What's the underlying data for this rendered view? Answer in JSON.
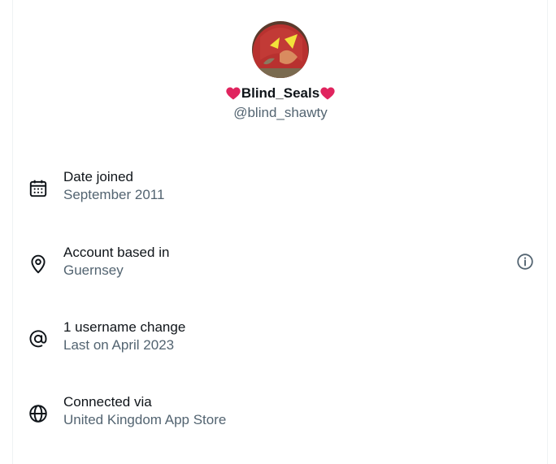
{
  "profile": {
    "display_name": "Blind_Seals",
    "handle": "@blind_shawty"
  },
  "rows": [
    {
      "icon": "calendar-icon",
      "title": "Date joined",
      "value": "September 2011"
    },
    {
      "icon": "location-pin-icon",
      "title": "Account based in",
      "value": "Guernsey"
    },
    {
      "icon": "at-sign-icon",
      "title": "1 username change",
      "value": "Last on April 2023"
    },
    {
      "icon": "globe-icon",
      "title": "Connected via",
      "value": "United Kingdom App Store"
    }
  ],
  "colors": {
    "primary_text": "#0f1419",
    "secondary_text": "#536471",
    "heart": "#e0245e",
    "border": "#eff3f4"
  }
}
